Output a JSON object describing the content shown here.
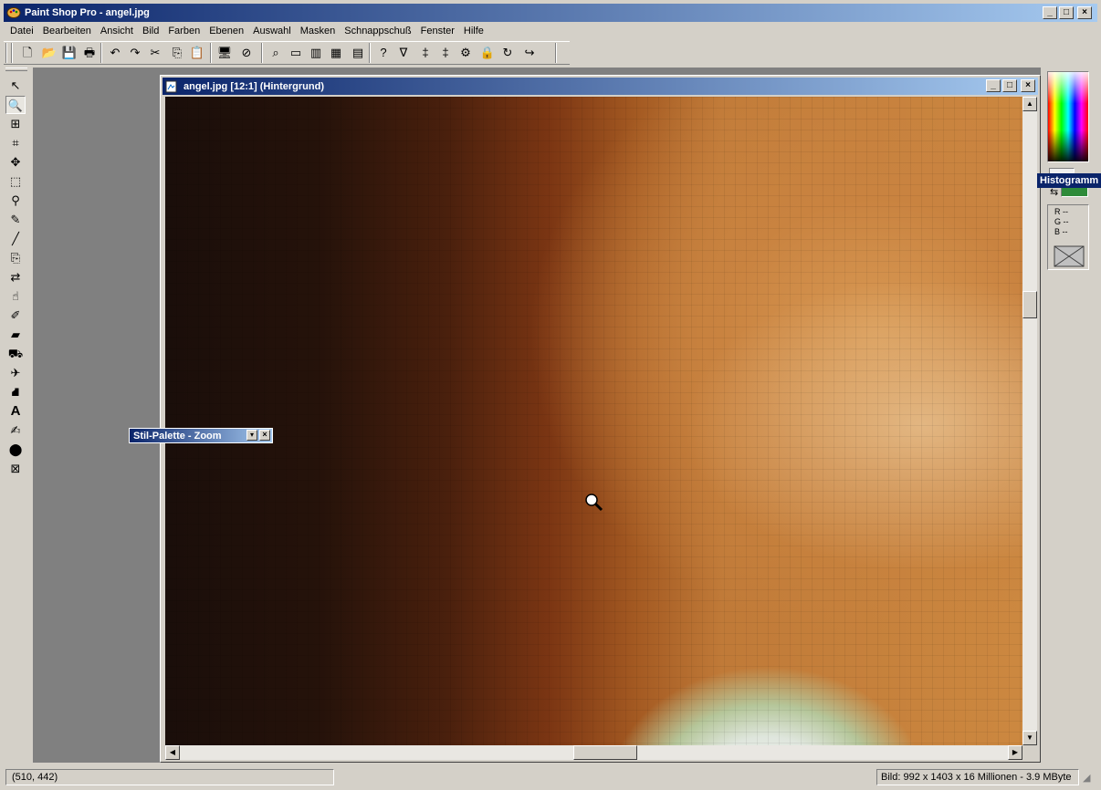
{
  "app": {
    "title": "Paint Shop Pro - angel.jpg",
    "window_buttons": {
      "minimize": "_",
      "maximize": "□",
      "close": "×"
    }
  },
  "menu": [
    "Datei",
    "Bearbeiten",
    "Ansicht",
    "Bild",
    "Farben",
    "Ebenen",
    "Auswahl",
    "Masken",
    "Schnappschuß",
    "Fenster",
    "Hilfe"
  ],
  "toolbar": {
    "icons": [
      "new-icon",
      "open-icon",
      "save-icon",
      "print-icon",
      "undo-icon",
      "redo-icon",
      "cut-icon",
      "copy-icon",
      "paste-icon",
      "monitor-icon",
      "browse-icon",
      "zoom-normal-icon",
      "toolbar-toggle-icon",
      "color-palette-icon",
      "histogram-icon",
      "layer-palette-icon",
      "help-icon",
      "filter-icon",
      "levels-icon",
      "color-balance-icon",
      "script-icon",
      "lock-icon",
      "refresh-icon",
      "run-script-icon"
    ],
    "glyphs": [
      "🗋",
      "📂",
      "💾",
      "🖶",
      "↶",
      "↷",
      "✂",
      "⎘",
      "📋",
      "🖥",
      "⊘",
      "⌕",
      "▭",
      "▥",
      "▦",
      "▤",
      "?",
      "∇",
      "‡",
      "‡",
      "⚙",
      "🔒",
      "↻",
      "↪"
    ]
  },
  "tools": {
    "icons": [
      "arrow-icon",
      "zoom-icon",
      "deform-icon",
      "crop-icon",
      "move-icon",
      "selection-icon",
      "freehand-icon",
      "dropper-icon",
      "paintbrush-icon",
      "clone-icon",
      "color-replace-icon",
      "retouch-icon",
      "scratch-remover-icon",
      "eraser-icon",
      "picture-tube-icon",
      "airbrush-icon",
      "flood-fill-icon",
      "text-icon",
      "draw-icon",
      "preset-shape-icon",
      "object-selector-icon"
    ],
    "glyphs": [
      "↖",
      "🔍",
      "⊞",
      "⌗",
      "✥",
      "⬚",
      "⚲",
      "✎",
      "╱",
      "⎘",
      "⇄",
      "☝",
      "✐",
      "▰",
      "⛟",
      "✈",
      "⛘",
      "A",
      "✍",
      "⬤",
      "⊠"
    ]
  },
  "image_window": {
    "title": "angel.jpg [12:1] (Hintergrund)"
  },
  "stil_palette": {
    "title": "Stil-Palette - Zoom"
  },
  "color_panel": {
    "tooltip": "Histogramm",
    "rgb": [
      "R --",
      "G --",
      "B --"
    ],
    "accent_color": "#2e8b3a"
  },
  "status": {
    "coords": "(510, 442)",
    "image_info": "Bild:  992 x 1403 x 16 Millionen - 3.9 MByte"
  },
  "colors": {
    "titlebar_start": "#0a246a",
    "titlebar_end": "#a6caf0",
    "workspace": "#808080",
    "face": "#d4d0c8"
  }
}
